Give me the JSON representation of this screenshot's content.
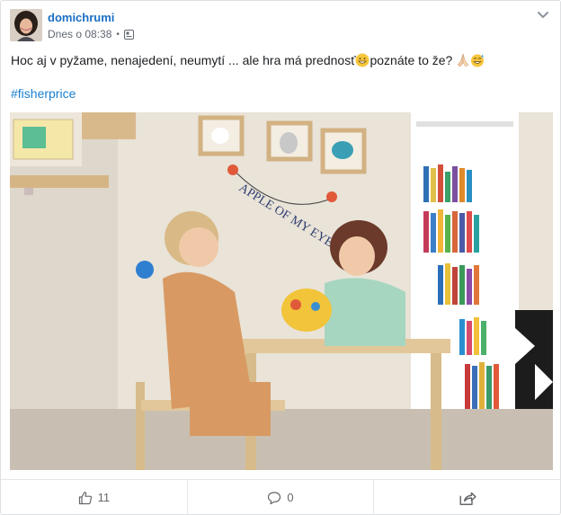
{
  "post": {
    "author": "domichrumi",
    "time": "Dnes o 08:38",
    "separator": "•",
    "privacy_icon": "public-icon",
    "text": "Hoc aj v pyžame, nenajedení, neumytí ... ale hra má prednosť",
    "text_after_emoji": " poznáte to že?",
    "hashtag": "#fisherprice",
    "photo_caption_text": "APPLE OF MY EYE"
  },
  "actions": {
    "like_count": "11",
    "comment_count": "0",
    "like_icon": "thumbs-up-icon",
    "comment_icon": "comment-icon",
    "share_icon": "share-icon"
  },
  "colors": {
    "author": "#1a6fc4",
    "hashtag": "#1a7fd0",
    "muted": "#606770"
  }
}
